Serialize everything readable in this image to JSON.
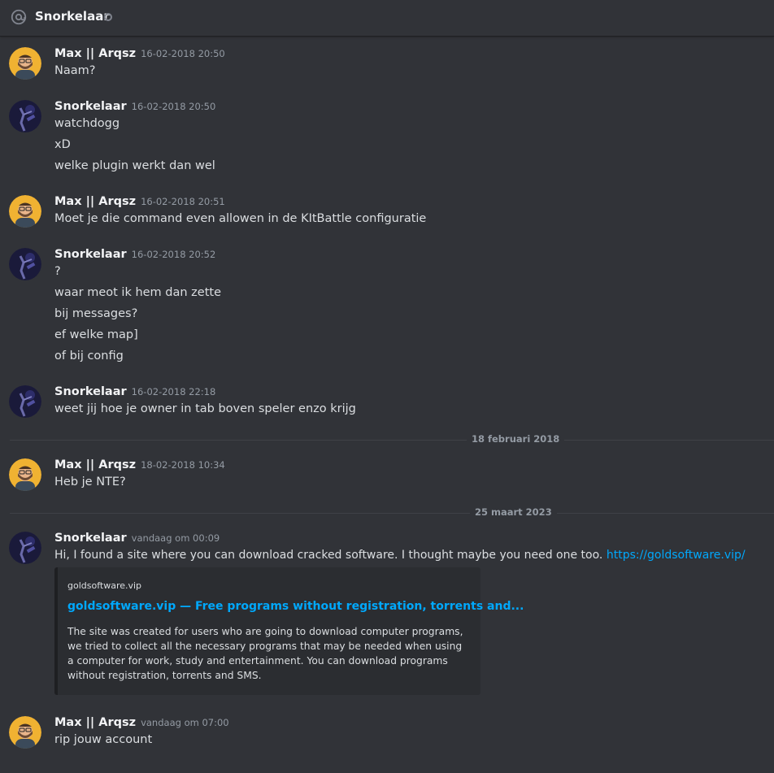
{
  "header": {
    "title": "Snorkelaar",
    "icon": "at-icon",
    "status": "offline"
  },
  "messages": [
    {
      "author": "Max || Arqsz",
      "timestamp": "16-02-2018 20:50",
      "lines": [
        "Naam?"
      ]
    },
    {
      "author": "Snorkelaar",
      "timestamp": "16-02-2018 20:50",
      "lines": [
        "watchdogg",
        "xD",
        "welke plugin werkt dan wel"
      ]
    },
    {
      "author": "Max || Arqsz",
      "timestamp": "16-02-2018 20:51",
      "lines": [
        "Moet je die command even allowen in de KItBattle configuratie"
      ]
    },
    {
      "author": "Snorkelaar",
      "timestamp": "16-02-2018 20:52",
      "lines": [
        "?",
        "waar meot ik hem dan zette",
        "bij messages?",
        "ef welke map]",
        "of bij config"
      ]
    },
    {
      "author": "Snorkelaar",
      "timestamp": "16-02-2018 22:18",
      "lines": [
        "weet jij hoe je owner in tab boven speler enzo krijg"
      ]
    },
    {
      "author": "Max || Arqsz",
      "timestamp": "18-02-2018 10:34",
      "lines": [
        "Heb je NTE?"
      ]
    },
    {
      "author": "Snorkelaar",
      "timestamp": "vandaag om 00:09",
      "lines": [
        "Hi, I found a site where you can download cracked software. I thought maybe you need one too."
      ],
      "link": "https://goldsoftware.vip/"
    },
    {
      "author": "Max || Arqsz",
      "timestamp": "vandaag om 07:00",
      "lines": [
        "rip jouw account"
      ]
    }
  ],
  "dividers": [
    "18 februari 2018",
    "25 maart 2023"
  ],
  "embed": {
    "provider": "goldsoftware.vip",
    "title": "goldsoftware.vip — Free programs without registration, torrents and...",
    "description": "The site was created for users who are going to download computer programs, we tried to collect all the necessary programs that may be needed when using a computer for work, study and entertainment. You can download programs without registration, torrents and SMS."
  },
  "colors": {
    "background": "#313338",
    "link": "#00a8fc",
    "avatar_max_bg": "#f0b232",
    "avatar_snork_bg": "#1a1a3a"
  }
}
